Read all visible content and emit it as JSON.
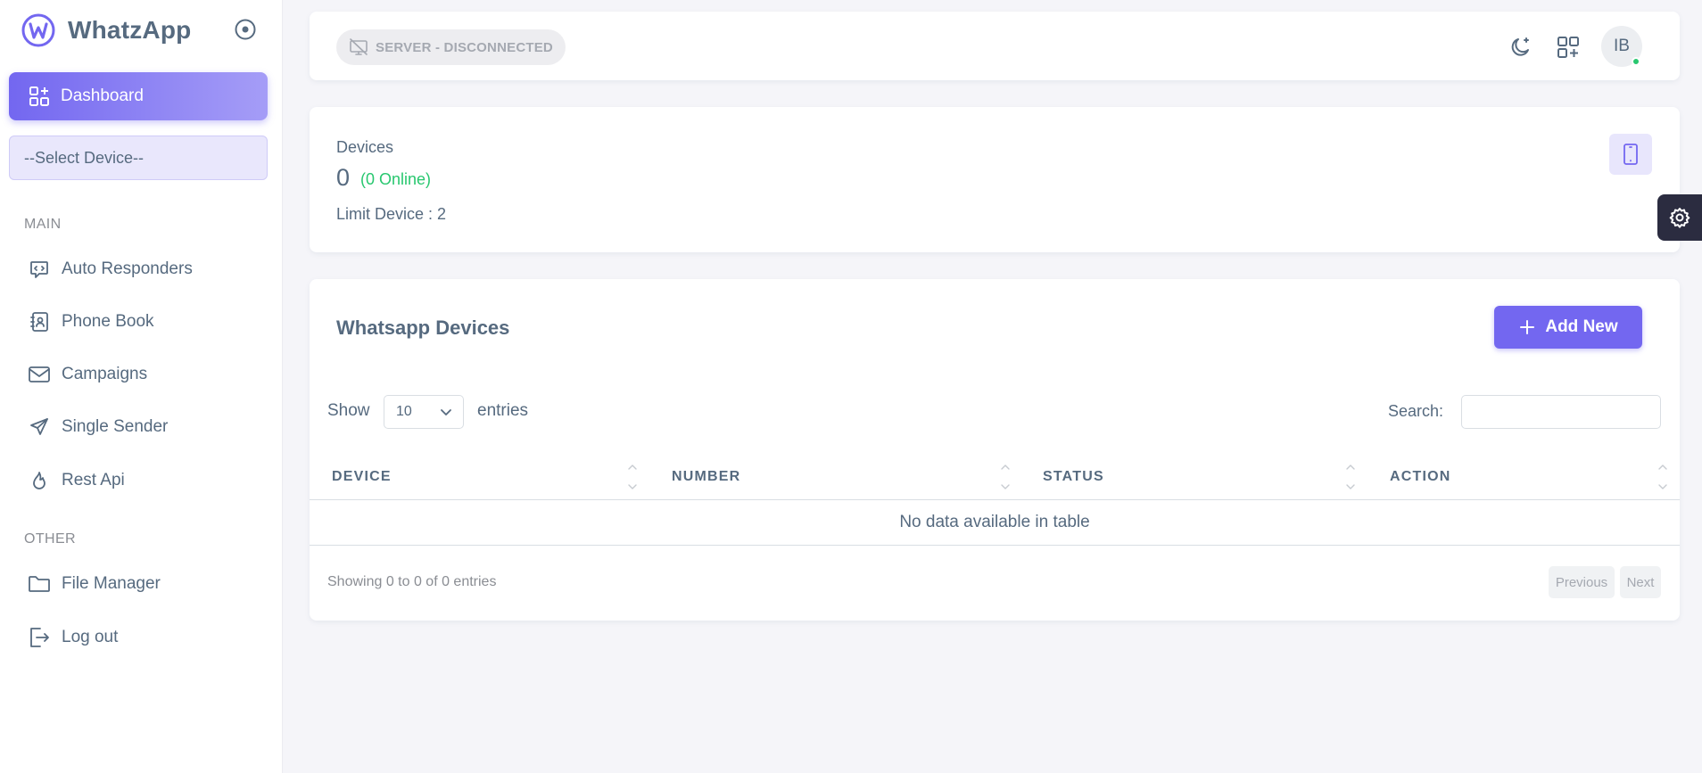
{
  "brand": {
    "name": "WhatzApp",
    "logo_letter": "W"
  },
  "sidebar": {
    "dashboard_label": "Dashboard",
    "select_device_label": "--Select Device--",
    "section_main": "MAIN",
    "main_items": [
      {
        "label": "Auto Responders",
        "icon": "chat-code-icon"
      },
      {
        "label": "Phone Book",
        "icon": "contact-book-icon"
      },
      {
        "label": "Campaigns",
        "icon": "mail-icon"
      },
      {
        "label": "Single Sender",
        "icon": "send-icon"
      },
      {
        "label": "Rest Api",
        "icon": "flame-icon"
      }
    ],
    "section_other": "OTHER",
    "other_items": [
      {
        "label": "File Manager",
        "icon": "folder-icon"
      },
      {
        "label": "Log out",
        "icon": "logout-icon"
      }
    ]
  },
  "topbar": {
    "server_status": "SERVER - DISCONNECTED",
    "avatar_initials": "IB",
    "online_color": "#28c76f"
  },
  "devices_card": {
    "label": "Devices",
    "count": "0",
    "online": "(0 Online)",
    "limit": "Limit Device : 2"
  },
  "table_card": {
    "title": "Whatsapp Devices",
    "add_button": "Add New",
    "show_label": "Show",
    "page_length": "10",
    "entries_label": "entries",
    "search_label": "Search:",
    "search_value": "",
    "columns": [
      "DEVICE",
      "NUMBER",
      "STATUS",
      "ACTION"
    ],
    "empty_message": "No data available in table",
    "info": "Showing 0 to 0 of 0 entries",
    "prev": "Previous",
    "next": "Next"
  },
  "colors": {
    "primary": "#7367f0",
    "success": "#28c76f",
    "text": "#566a7f",
    "background": "#f5f5f9"
  }
}
